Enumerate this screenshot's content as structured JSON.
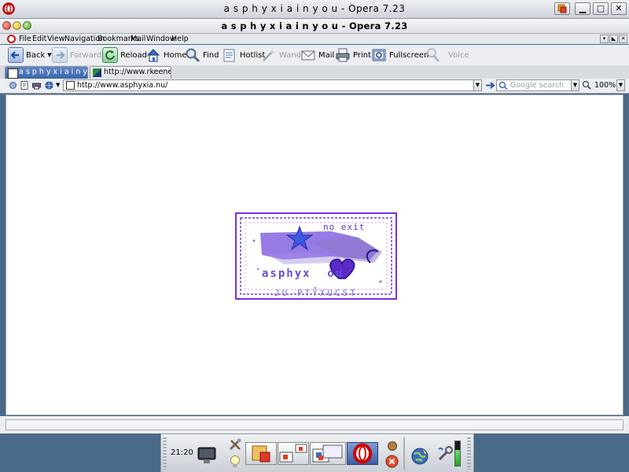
{
  "window": {
    "outer_title": "a s p h y x i a i n y o u - Opera 7.23",
    "inner_title": "a s p h y x i a i n y o u - Opera 7.23"
  },
  "menu": [
    "File",
    "Edit",
    "View",
    "Navigation",
    "Bookmarks",
    "Mail",
    "Window",
    "Help"
  ],
  "toolbar": {
    "back": "Back",
    "forward": "Forward",
    "reload": "Reload",
    "home": "Home",
    "find": "Find",
    "hotlist": "Hotlist",
    "wand": "Wand",
    "mail": "Mail",
    "print": "Print",
    "fullscreen": "Fullscreen",
    "voice": "Voice"
  },
  "tabs": [
    {
      "label": "a s p h y x i a i n y o u",
      "active": true
    },
    {
      "label": "http://www.rkeene.o...",
      "active": false
    }
  ],
  "address": {
    "url": "http://www.asphyxia.nu/",
    "search_placeholder": "Google search",
    "zoom": "100%"
  },
  "banner": {
    "top_text": "no exit",
    "middle_text": "asphyx  ou",
    "bottom_text": "JU PTYXUCST"
  },
  "taskbar": {
    "clock": "21:20"
  },
  "colors": {
    "banner_border": "#7a2ee0",
    "banner_ink": "#6a3ad8",
    "desktop": "#4a6a8a"
  }
}
